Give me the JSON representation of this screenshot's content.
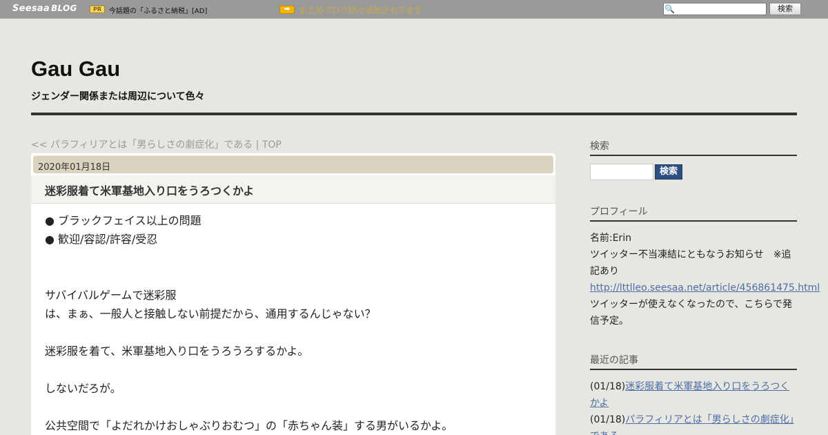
{
  "topbar": {
    "logo_seesaa": "Seesaa",
    "logo_blog": "BLOG",
    "pr_badge": "PR",
    "ad_text": "今話題の「ふるさと納税」[AD]",
    "arrow_icon": "arrow-right-icon",
    "news_text": "まとめブログ続々追加されてます",
    "search_icon": "magnifier-icon",
    "search_value": "",
    "search_button": "検索"
  },
  "header": {
    "title": "Gau Gau",
    "description": "ジェンダー関係または周辺について色々"
  },
  "breadcrumb": {
    "prev_link": "<< パラフィリアとは「男らしさの劇症化」である",
    "separator": " | ",
    "top_link": "TOP"
  },
  "article": {
    "date": "2020年01月18日",
    "title": "迷彩服着て米軍基地入り口をうろつくかよ",
    "lines": [
      "● ブラックフェイス以上の問題",
      "● 歓迎/容認/許容/受忍",
      "",
      "",
      "サバイバルゲームで迷彩服",
      "は、まぁ、一般人と接触しない前提だから、通用するんじゃない？",
      "",
      "迷彩服を着て、米軍基地入り口をうろうろするかよ。",
      "",
      "しないだろが。",
      "",
      "公共空間で「よだれかけおしゃぶりおむつ」の「赤ちゃん装」する男がいるかよ。"
    ]
  },
  "sidebar": {
    "search": {
      "heading": "検索",
      "input_value": "",
      "button": "検索"
    },
    "profile": {
      "heading": "プロフィール",
      "name_line": "名前:Erin",
      "notice_line": "ツイッター不当凍結にともなうお知らせ　※追記あり",
      "link": "http://lttlleo.seesaa.net/article/456861475.html",
      "after_link": "ツイッターが使えなくなったので、こちらで発信予定。"
    },
    "recent": {
      "heading": "最近の記事",
      "items": [
        {
          "date": "(01/18)",
          "title": "迷彩服着て米軍基地入り口をうろつくかよ"
        },
        {
          "date": "(01/18)",
          "title": "パラフィリアとは「男らしさの劇症化」である"
        }
      ]
    }
  }
}
